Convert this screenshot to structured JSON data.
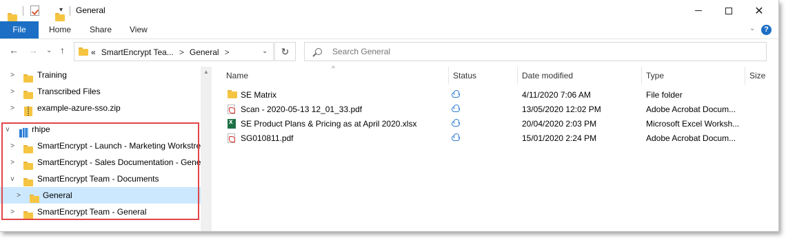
{
  "window": {
    "title": "General"
  },
  "ribbon": {
    "tabs": [
      {
        "label": "File"
      },
      {
        "label": "Home"
      },
      {
        "label": "Share"
      },
      {
        "label": "View"
      }
    ],
    "help": "?"
  },
  "address": {
    "overflow": "«",
    "crumbs": [
      "SmartEncrypt Tea...",
      "General"
    ],
    "separator": ">"
  },
  "search": {
    "placeholder": "Search General"
  },
  "nav_tree": [
    {
      "label": "Training",
      "icon": "folder-icon",
      "expander": ">"
    },
    {
      "label": "Transcribed Files",
      "icon": "folder-icon",
      "expander": ">"
    },
    {
      "label": "example-azure-sso.zip",
      "icon": "zip-icon",
      "expander": ">"
    },
    {
      "label": "rhipe",
      "icon": "sharepoint-icon",
      "expander": "v"
    },
    {
      "label": "SmartEncrypt - Launch - Marketing Workstre",
      "icon": "folder-icon",
      "expander": ">"
    },
    {
      "label": "SmartEncrypt - Sales Documentation - Gene",
      "icon": "folder-icon",
      "expander": ">"
    },
    {
      "label": "SmartEncrypt Team - Documents",
      "icon": "folder-icon",
      "expander": "v"
    },
    {
      "label": "General",
      "icon": "folder-icon",
      "expander": ">",
      "selected": true
    },
    {
      "label": "SmartEncrypt Team - General",
      "icon": "folder-icon",
      "expander": ">"
    }
  ],
  "columns": {
    "name": "Name",
    "status": "Status",
    "date": "Date modified",
    "type": "Type",
    "size": "Size"
  },
  "files": [
    {
      "name": "SE Matrix",
      "icon": "folder-icon",
      "status": "cloud-icon",
      "date": "4/11/2020 7:06 AM",
      "type": "File folder"
    },
    {
      "name": "Scan - 2020-05-13 12_01_33.pdf",
      "icon": "pdf-icon",
      "status": "cloud-icon",
      "date": "13/05/2020 12:02 PM",
      "type": "Adobe Acrobat Docum..."
    },
    {
      "name": "SE Product Plans & Pricing as at April 2020.xlsx",
      "icon": "excel-icon",
      "status": "cloud-icon",
      "date": "20/04/2020 2:03 PM",
      "type": "Microsoft Excel Worksh..."
    },
    {
      "name": "SG010811.pdf",
      "icon": "pdf-icon",
      "status": "cloud-icon",
      "date": "15/01/2020 2:24 PM",
      "type": "Adobe Acrobat Docum..."
    }
  ],
  "colors": {
    "accent": "#1c6fc4",
    "selection": "#cce8ff",
    "highlight": "#e04446"
  }
}
